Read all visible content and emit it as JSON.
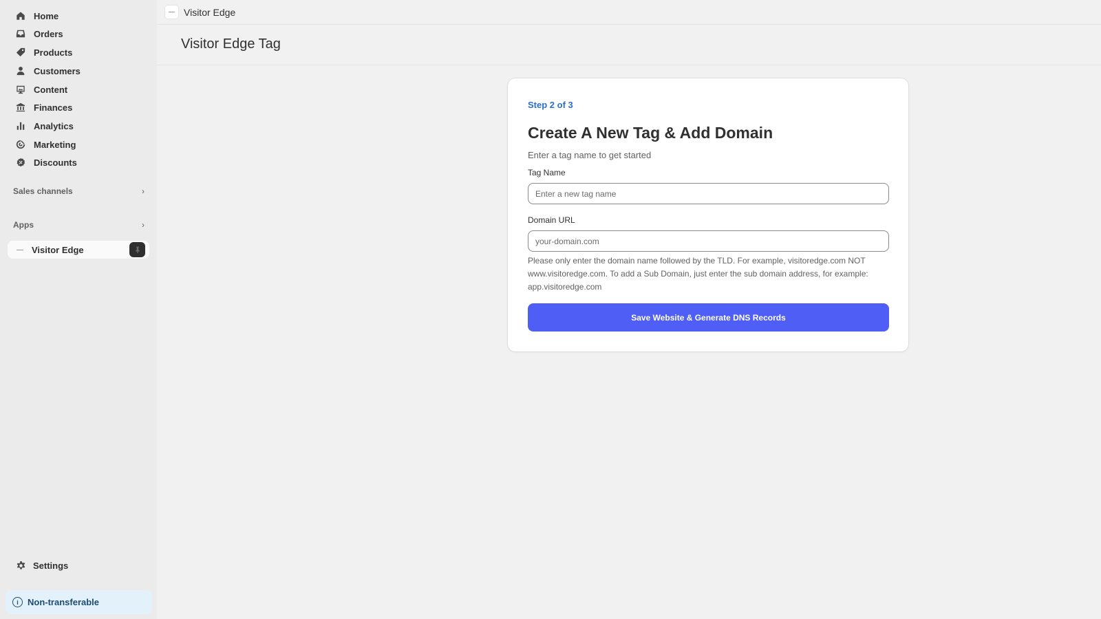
{
  "sidebar": {
    "items": [
      {
        "label": "Home",
        "icon": "home-icon"
      },
      {
        "label": "Orders",
        "icon": "inbox-icon"
      },
      {
        "label": "Products",
        "icon": "tag-icon"
      },
      {
        "label": "Customers",
        "icon": "person-icon"
      },
      {
        "label": "Content",
        "icon": "image-icon"
      },
      {
        "label": "Finances",
        "icon": "bank-icon"
      },
      {
        "label": "Analytics",
        "icon": "bar-chart-icon"
      },
      {
        "label": "Marketing",
        "icon": "target-icon"
      },
      {
        "label": "Discounts",
        "icon": "discount-icon"
      }
    ],
    "sales_channels_label": "Sales channels",
    "apps_label": "Apps",
    "pinned_app": {
      "label": "Visitor Edge",
      "icon": "pin-icon"
    },
    "settings_label": "Settings",
    "notice": {
      "label": "Non-transferable",
      "icon": "info-icon",
      "color": "#1f4b6e"
    }
  },
  "topbar": {
    "app_name": "Visitor Edge"
  },
  "page": {
    "title": "Visitor Edge Tag"
  },
  "card": {
    "step": "Step 2 of 3",
    "title": "Create A New Tag & Add Domain",
    "subtitle": "Enter a tag name to get started",
    "tag_name_label": "Tag Name",
    "tag_name_placeholder": "Enter a new tag name",
    "tag_name_value": "",
    "domain_label": "Domain URL",
    "domain_placeholder": "your-domain.com",
    "domain_value": "",
    "help_text": "Please only enter the domain name followed by the TLD. For example, visitoredge.com NOT www.visitoredge.com. To add a Sub Domain, just enter the sub domain address, for example: app.visitoredge.com",
    "submit_label": "Save Website & Generate DNS Records"
  },
  "colors": {
    "accent": "#4f5ff5",
    "step_color": "#2c6ecb",
    "background": "#f1f1f1",
    "sidebar": "#ebebeb"
  }
}
